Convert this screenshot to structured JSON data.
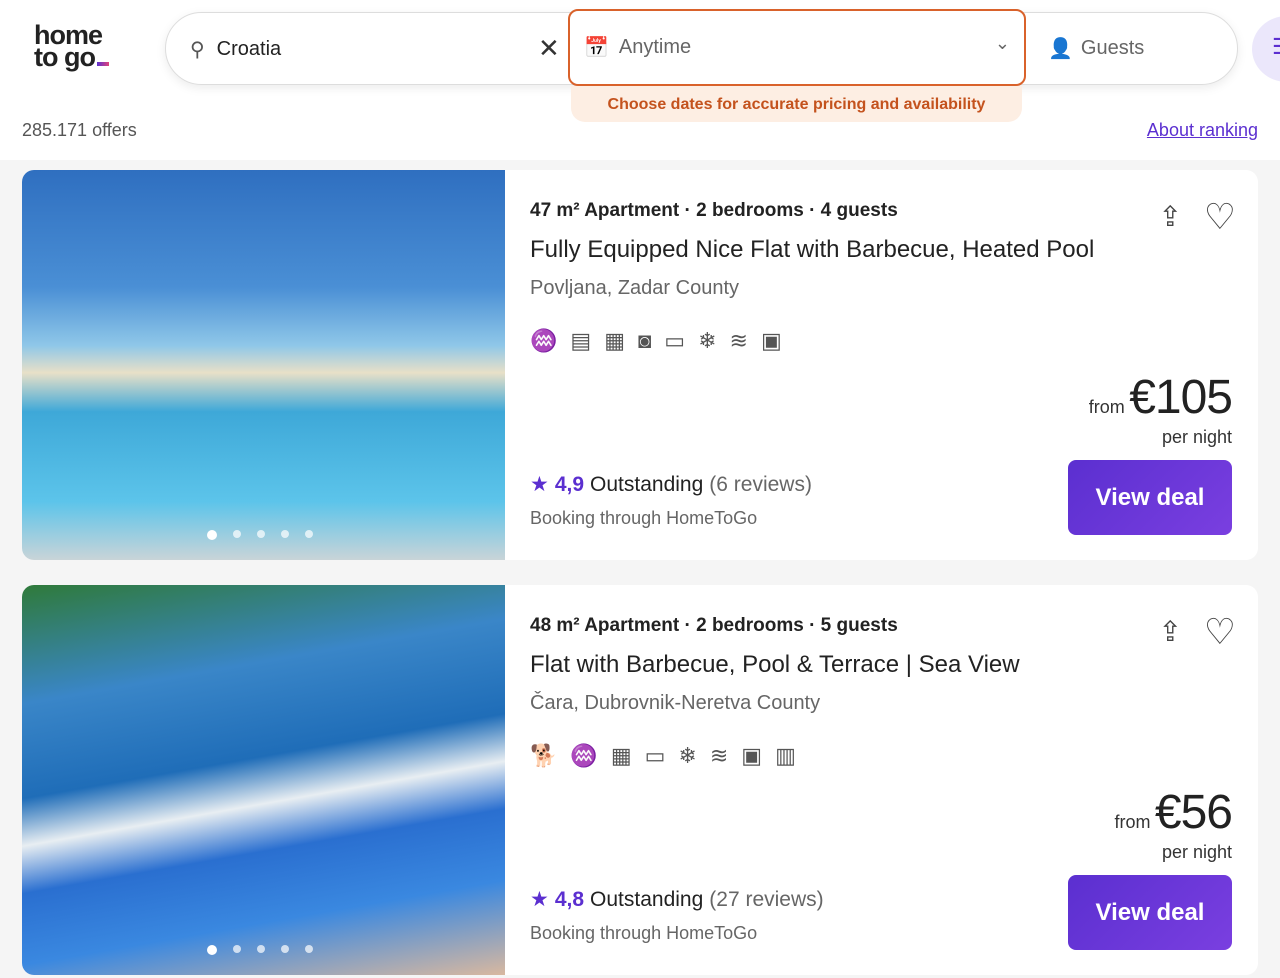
{
  "logo": {
    "line1": "home",
    "line2": "to go"
  },
  "search": {
    "location": "Croatia",
    "dates": "Anytime",
    "guests": "Guests",
    "hint": "Choose dates for accurate pricing and availability"
  },
  "results": {
    "count": "285.171 offers",
    "about": "About ranking"
  },
  "colors": {
    "accent": "#5b2fd0",
    "warning": "#d9622b"
  },
  "listings": [
    {
      "specs": "47 m² Apartment · 2 bedrooms · 4 guests",
      "title": "Fully Equipped Nice Flat with Barbecue, Heated Pool",
      "place": "Povljana, Zadar County",
      "amenities": [
        "pool-icon",
        "dishwasher-icon",
        "balcony-icon",
        "washing-machine-icon",
        "tv-icon",
        "air-conditioning-icon",
        "wifi-icon",
        "microwave-icon"
      ],
      "from": "from",
      "price": "€105",
      "per": "per night",
      "score": "4,9",
      "label": "Outstanding",
      "reviews": "(6 reviews)",
      "booking": "Booking through HomeToGo",
      "cta": "View deal"
    },
    {
      "specs": "48 m² Apartment · 2 bedrooms · 5 guests",
      "title": "Flat with Barbecue, Pool & Terrace | Sea View",
      "place": "Čara, Dubrovnik-Neretva County",
      "amenities": [
        "pets-icon",
        "pool-icon",
        "balcony-icon",
        "tv-icon",
        "air-conditioning-icon",
        "wifi-icon",
        "microwave-icon",
        "crib-icon"
      ],
      "from": "from",
      "price": "€56",
      "per": "per night",
      "score": "4,8",
      "label": "Outstanding",
      "reviews": "(27 reviews)",
      "booking": "Booking through HomeToGo",
      "cta": "View deal"
    }
  ]
}
